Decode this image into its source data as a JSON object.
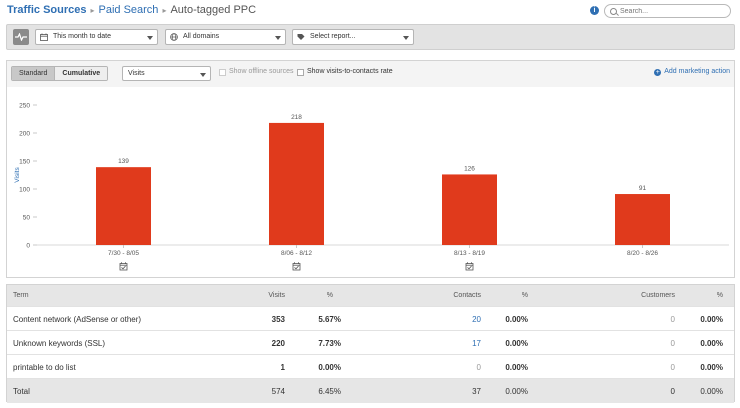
{
  "breadcrumb": {
    "items": [
      "Traffic Sources",
      "Paid Search",
      "Auto-tagged PPC"
    ]
  },
  "search": {
    "placeholder": "Search..."
  },
  "filters": {
    "date_range": "This month to date",
    "domains": "All domains",
    "report": "Select report..."
  },
  "chart_controls": {
    "standard_label": "Standard",
    "cumulative_label": "Cumulative",
    "metric": "Visits",
    "offline_label": "Show offline sources",
    "contacts_rate_label": "Show visits-to-contacts rate",
    "add_action_label": "Add marketing action"
  },
  "chart_data": {
    "type": "bar",
    "categories": [
      "7/30 - 8/05",
      "8/06 - 8/12",
      "8/13 - 8/19",
      "8/20 - 8/26"
    ],
    "values": [
      139,
      218,
      126,
      91
    ],
    "ylabel": "Visits",
    "ylim": [
      0,
      250
    ],
    "yticks": [
      0,
      50,
      100,
      150,
      200,
      250
    ],
    "bar_color": "#e03a1c",
    "marked_categories": [
      0,
      1,
      2
    ]
  },
  "table": {
    "headers": {
      "term": "Term",
      "visits": "Visits",
      "visits_pct": "%",
      "contacts": "Contacts",
      "contacts_pct": "%",
      "customers": "Customers",
      "customers_pct": "%"
    },
    "rows": [
      {
        "term": "Content network (AdSense or other)",
        "visits": "353",
        "visits_pct": "5.67%",
        "contacts": "20",
        "contacts_pct": "0.00%",
        "customers": "0",
        "customers_pct": "0.00%"
      },
      {
        "term": "Unknown keywords (SSL)",
        "visits": "220",
        "visits_pct": "7.73%",
        "contacts": "17",
        "contacts_pct": "0.00%",
        "customers": "0",
        "customers_pct": "0.00%"
      },
      {
        "term": "printable to do list",
        "visits": "1",
        "visits_pct": "0.00%",
        "contacts": "0",
        "contacts_pct": "0.00%",
        "customers": "0",
        "customers_pct": "0.00%"
      }
    ],
    "total": {
      "term": "Total",
      "visits": "574",
      "visits_pct": "6.45%",
      "contacts": "37",
      "contacts_pct": "0.00%",
      "customers": "0",
      "customers_pct": "0.00%"
    }
  },
  "colors": {
    "link": "#2f6fb3",
    "bar": "#e03a1c",
    "header_bg": "#e6e6e6"
  },
  "icons": {
    "info": "info-icon",
    "search": "search-icon",
    "calendar": "calendar-icon",
    "globe": "globe-icon",
    "report": "report-icon",
    "add": "plus-circle-icon",
    "marker": "calendar-check-icon"
  }
}
